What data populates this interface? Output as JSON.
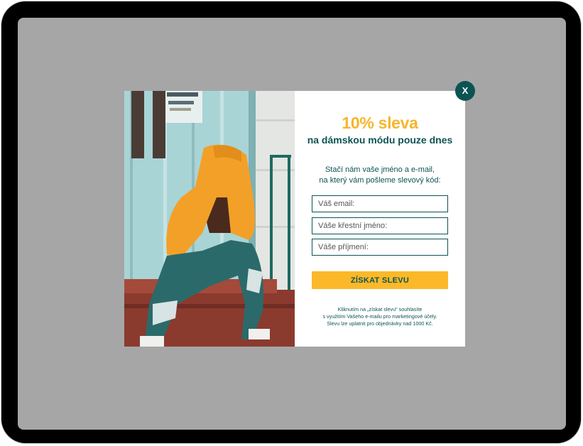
{
  "popup": {
    "close_label": "X",
    "headline": "10% sleva",
    "subheadline": "na dámskou módu pouze dnes",
    "description_lines": [
      "Stačí nám vaše jméno a e-mail,",
      "na který vám pošleme slevový kód:"
    ],
    "email_placeholder": "Váš email:",
    "first_name_placeholder": "Váše křestní jméno:",
    "last_name_placeholder": "Váše příjmení:",
    "submit_label": "ZÍSKAT SLEVU",
    "legal_lines": [
      "Kliknutím na „získat slevu\" souhlasíte",
      "s využitím Vašeho e-mailu pro marketingové účely.",
      "Slevu lze uplatnit pro objednávky nad 1000 Kč."
    ]
  },
  "colors": {
    "accent": "#fbb829",
    "brand": "#0c5353",
    "overlay": "#a6a6a6"
  }
}
